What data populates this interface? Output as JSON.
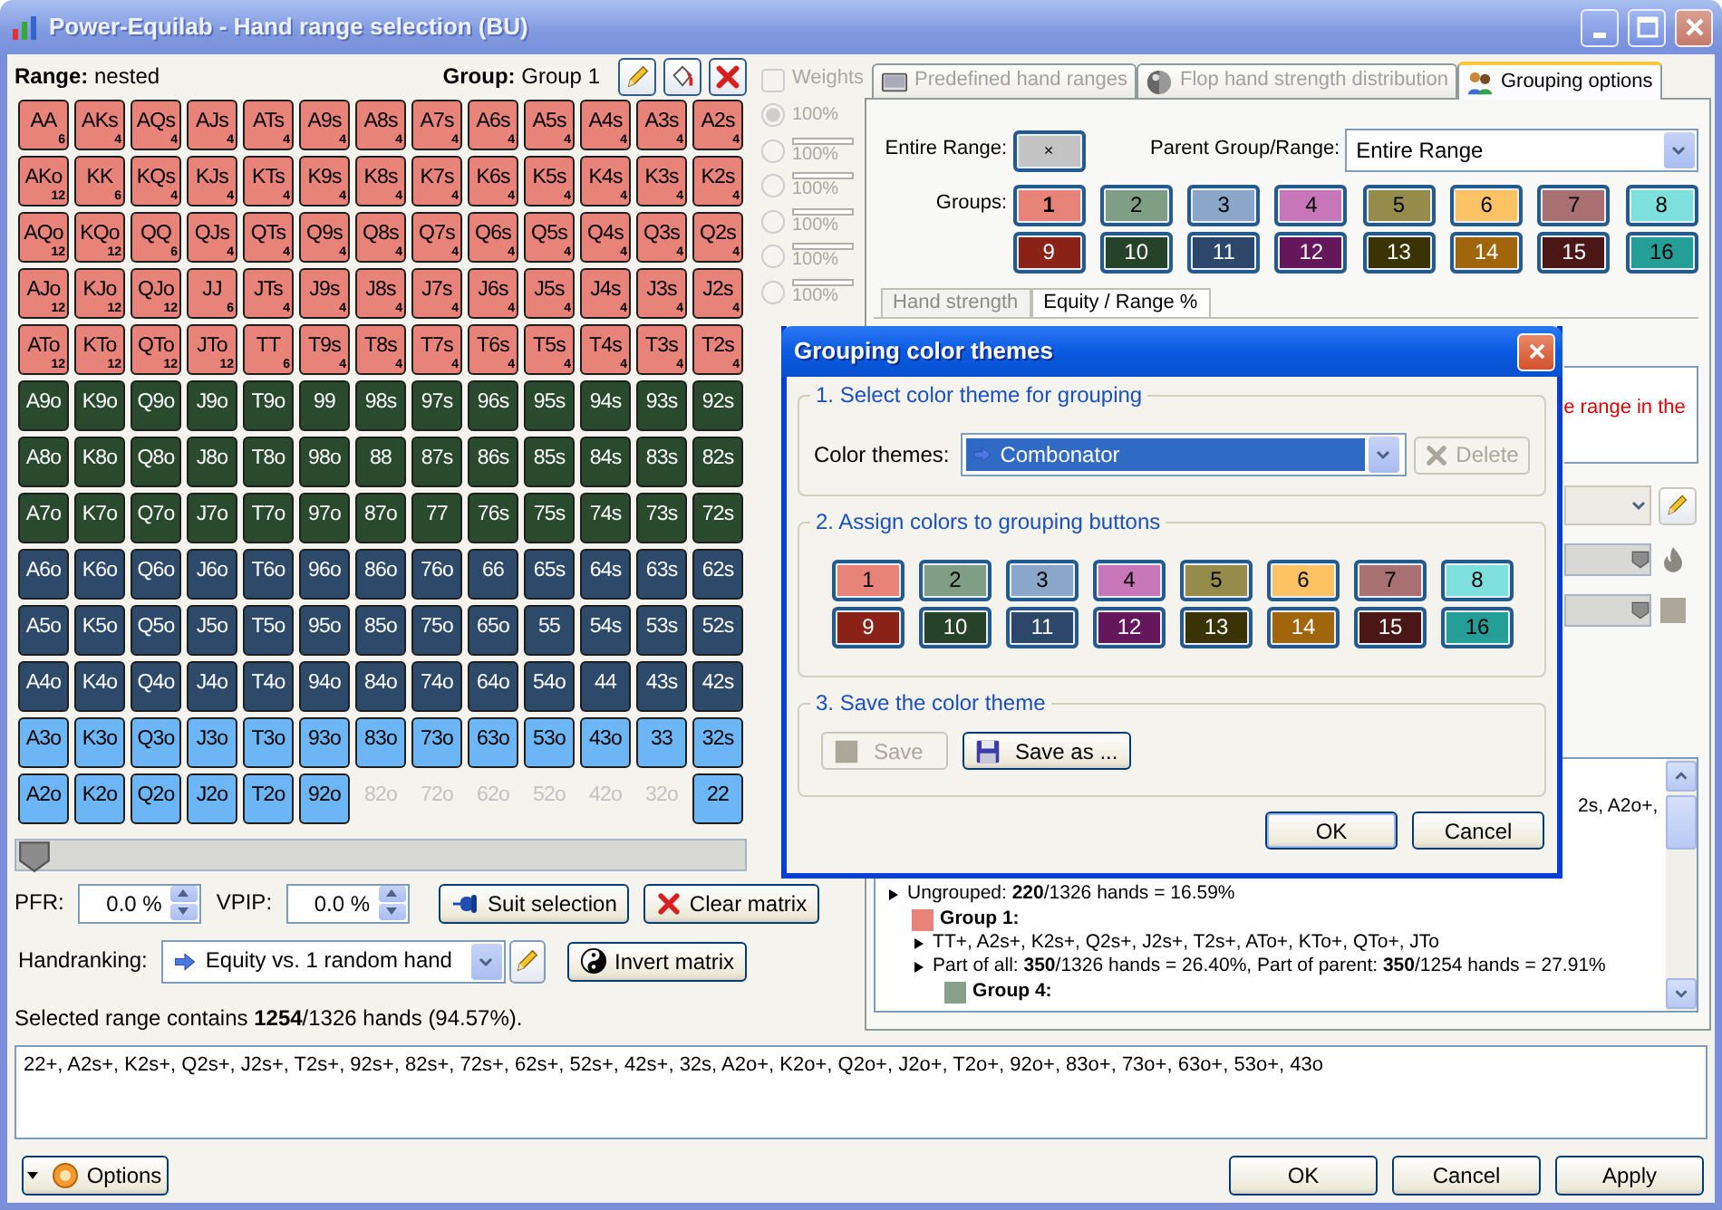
{
  "window": {
    "title": "Power-Equilab - Hand range selection (BU)"
  },
  "range_header": {
    "range_label": "**Range:** nested",
    "group_label": "**Group:** Group 1"
  },
  "matrix": {
    "rows": [
      {
        "cells": [
          {
            "hand": "AA",
            "combos": "6",
            "selected": true,
            "color": "#e8837a"
          },
          {
            "hand": "AKs",
            "combos": "4",
            "selected": true,
            "color": "#e8837a"
          },
          {
            "hand": "AQs",
            "combos": "4",
            "selected": true,
            "color": "#e8837a"
          },
          {
            "hand": "AJs",
            "combos": "4",
            "selected": true,
            "color": "#e8837a"
          },
          {
            "hand": "ATs",
            "combos": "4",
            "selected": true,
            "color": "#e8837a"
          },
          {
            "hand": "A9s",
            "combos": "4",
            "selected": true,
            "color": "#e8837a"
          },
          {
            "hand": "A8s",
            "combos": "4",
            "selected": true,
            "color": "#e8837a"
          },
          {
            "hand": "A7s",
            "combos": "4",
            "selected": true,
            "color": "#e8837a"
          },
          {
            "hand": "A6s",
            "combos": "4",
            "selected": true,
            "color": "#e8837a"
          },
          {
            "hand": "A5s",
            "combos": "4",
            "selected": true,
            "color": "#e8837a"
          },
          {
            "hand": "A4s",
            "combos": "4",
            "selected": true,
            "color": "#e8837a"
          },
          {
            "hand": "A3s",
            "combos": "4",
            "selected": true,
            "color": "#e8837a"
          },
          {
            "hand": "A2s",
            "combos": "4",
            "selected": true,
            "color": "#e8837a"
          }
        ]
      },
      {
        "cells": [
          {
            "hand": "AKo",
            "combos": "12",
            "selected": true,
            "color": "#e8837a"
          },
          {
            "hand": "KK",
            "combos": "6",
            "selected": true,
            "color": "#e8837a"
          },
          {
            "hand": "KQs",
            "combos": "4",
            "selected": true,
            "color": "#e8837a"
          },
          {
            "hand": "KJs",
            "combos": "4",
            "selected": true,
            "color": "#e8837a"
          },
          {
            "hand": "KTs",
            "combos": "4",
            "selected": true,
            "color": "#e8837a"
          },
          {
            "hand": "K9s",
            "combos": "4",
            "selected": true,
            "color": "#e8837a"
          },
          {
            "hand": "K8s",
            "combos": "4",
            "selected": true,
            "color": "#e8837a"
          },
          {
            "hand": "K7s",
            "combos": "4",
            "selected": true,
            "color": "#e8837a"
          },
          {
            "hand": "K6s",
            "combos": "4",
            "selected": true,
            "color": "#e8837a"
          },
          {
            "hand": "K5s",
            "combos": "4",
            "selected": true,
            "color": "#e8837a"
          },
          {
            "hand": "K4s",
            "combos": "4",
            "selected": true,
            "color": "#e8837a"
          },
          {
            "hand": "K3s",
            "combos": "4",
            "selected": true,
            "color": "#e8837a"
          },
          {
            "hand": "K2s",
            "combos": "4",
            "selected": true,
            "color": "#e8837a"
          }
        ]
      },
      {
        "cells": [
          {
            "hand": "AQo",
            "combos": "12",
            "selected": true,
            "color": "#e8837a"
          },
          {
            "hand": "KQo",
            "combos": "12",
            "selected": true,
            "color": "#e8837a"
          },
          {
            "hand": "QQ",
            "combos": "6",
            "selected": true,
            "color": "#e8837a"
          },
          {
            "hand": "QJs",
            "combos": "4",
            "selected": true,
            "color": "#e8837a"
          },
          {
            "hand": "QTs",
            "combos": "4",
            "selected": true,
            "color": "#e8837a"
          },
          {
            "hand": "Q9s",
            "combos": "4",
            "selected": true,
            "color": "#e8837a"
          },
          {
            "hand": "Q8s",
            "combos": "4",
            "selected": true,
            "color": "#e8837a"
          },
          {
            "hand": "Q7s",
            "combos": "4",
            "selected": true,
            "color": "#e8837a"
          },
          {
            "hand": "Q6s",
            "combos": "4",
            "selected": true,
            "color": "#e8837a"
          },
          {
            "hand": "Q5s",
            "combos": "4",
            "selected": true,
            "color": "#e8837a"
          },
          {
            "hand": "Q4s",
            "combos": "4",
            "selected": true,
            "color": "#e8837a"
          },
          {
            "hand": "Q3s",
            "combos": "4",
            "selected": true,
            "color": "#e8837a"
          },
          {
            "hand": "Q2s",
            "combos": "4",
            "selected": true,
            "color": "#e8837a"
          }
        ]
      },
      {
        "cells": [
          {
            "hand": "AJo",
            "combos": "12",
            "selected": true,
            "color": "#e8837a"
          },
          {
            "hand": "KJo",
            "combos": "12",
            "selected": true,
            "color": "#e8837a"
          },
          {
            "hand": "QJo",
            "combos": "12",
            "selected": true,
            "color": "#e8837a"
          },
          {
            "hand": "JJ",
            "combos": "6",
            "selected": true,
            "color": "#e8837a"
          },
          {
            "hand": "JTs",
            "combos": "4",
            "selected": true,
            "color": "#e8837a"
          },
          {
            "hand": "J9s",
            "combos": "4",
            "selected": true,
            "color": "#e8837a"
          },
          {
            "hand": "J8s",
            "combos": "4",
            "selected": true,
            "color": "#e8837a"
          },
          {
            "hand": "J7s",
            "combos": "4",
            "selected": true,
            "color": "#e8837a"
          },
          {
            "hand": "J6s",
            "combos": "4",
            "selected": true,
            "color": "#e8837a"
          },
          {
            "hand": "J5s",
            "combos": "4",
            "selected": true,
            "color": "#e8837a"
          },
          {
            "hand": "J4s",
            "combos": "4",
            "selected": true,
            "color": "#e8837a"
          },
          {
            "hand": "J3s",
            "combos": "4",
            "selected": true,
            "color": "#e8837a"
          },
          {
            "hand": "J2s",
            "combos": "4",
            "selected": true,
            "color": "#e8837a"
          }
        ]
      },
      {
        "cells": [
          {
            "hand": "ATo",
            "combos": "12",
            "selected": true,
            "color": "#e8837a"
          },
          {
            "hand": "KTo",
            "combos": "12",
            "selected": true,
            "color": "#e8837a"
          },
          {
            "hand": "QTo",
            "combos": "12",
            "selected": true,
            "color": "#e8837a"
          },
          {
            "hand": "JTo",
            "combos": "12",
            "selected": true,
            "color": "#e8837a"
          },
          {
            "hand": "TT",
            "combos": "6",
            "selected": true,
            "color": "#e8837a"
          },
          {
            "hand": "T9s",
            "combos": "4",
            "selected": true,
            "color": "#e8837a"
          },
          {
            "hand": "T8s",
            "combos": "4",
            "selected": true,
            "color": "#e8837a"
          },
          {
            "hand": "T7s",
            "combos": "4",
            "selected": true,
            "color": "#e8837a"
          },
          {
            "hand": "T6s",
            "combos": "4",
            "selected": true,
            "color": "#e8837a"
          },
          {
            "hand": "T5s",
            "combos": "4",
            "selected": true,
            "color": "#e8837a"
          },
          {
            "hand": "T4s",
            "combos": "4",
            "selected": true,
            "color": "#e8837a"
          },
          {
            "hand": "T3s",
            "combos": "4",
            "selected": true,
            "color": "#e8837a"
          },
          {
            "hand": "T2s",
            "combos": "4",
            "selected": true,
            "color": "#e8837a"
          }
        ]
      },
      {
        "cells": [
          {
            "hand": "A9o",
            "selected": true,
            "color": "#2a4a2d"
          },
          {
            "hand": "K9o",
            "selected": true,
            "color": "#2a4a2d"
          },
          {
            "hand": "Q9o",
            "selected": true,
            "color": "#2a4a2d"
          },
          {
            "hand": "J9o",
            "selected": true,
            "color": "#2a4a2d"
          },
          {
            "hand": "T9o",
            "selected": true,
            "color": "#2a4a2d"
          },
          {
            "hand": "99",
            "selected": true,
            "color": "#2a4a2d"
          },
          {
            "hand": "98s",
            "selected": true,
            "color": "#2a4a2d"
          },
          {
            "hand": "97s",
            "selected": true,
            "color": "#2a4a2d"
          },
          {
            "hand": "96s",
            "selected": true,
            "color": "#2a4a2d"
          },
          {
            "hand": "95s",
            "selected": true,
            "color": "#2a4a2d"
          },
          {
            "hand": "94s",
            "selected": true,
            "color": "#2a4a2d"
          },
          {
            "hand": "93s",
            "selected": true,
            "color": "#2a4a2d"
          },
          {
            "hand": "92s",
            "selected": true,
            "color": "#2a4a2d"
          }
        ]
      },
      {
        "cells": [
          {
            "hand": "A8o",
            "selected": true,
            "color": "#2a4a2d"
          },
          {
            "hand": "K8o",
            "selected": true,
            "color": "#2a4a2d"
          },
          {
            "hand": "Q8o",
            "selected": true,
            "color": "#2a4a2d"
          },
          {
            "hand": "J8o",
            "selected": true,
            "color": "#2a4a2d"
          },
          {
            "hand": "T8o",
            "selected": true,
            "color": "#2a4a2d"
          },
          {
            "hand": "98o",
            "selected": true,
            "color": "#2a4a2d"
          },
          {
            "hand": "88",
            "selected": true,
            "color": "#2a4a2d"
          },
          {
            "hand": "87s",
            "selected": true,
            "color": "#2a4a2d"
          },
          {
            "hand": "86s",
            "selected": true,
            "color": "#2a4a2d"
          },
          {
            "hand": "85s",
            "selected": true,
            "color": "#2a4a2d"
          },
          {
            "hand": "84s",
            "selected": true,
            "color": "#2a4a2d"
          },
          {
            "hand": "83s",
            "selected": true,
            "color": "#2a4a2d"
          },
          {
            "hand": "82s",
            "selected": true,
            "color": "#2a4a2d"
          }
        ]
      },
      {
        "cells": [
          {
            "hand": "A7o",
            "selected": true,
            "color": "#2a4a2d"
          },
          {
            "hand": "K7o",
            "selected": true,
            "color": "#2a4a2d"
          },
          {
            "hand": "Q7o",
            "selected": true,
            "color": "#2a4a2d"
          },
          {
            "hand": "J7o",
            "selected": true,
            "color": "#2a4a2d"
          },
          {
            "hand": "T7o",
            "selected": true,
            "color": "#2a4a2d"
          },
          {
            "hand": "97o",
            "selected": true,
            "color": "#2a4a2d"
          },
          {
            "hand": "87o",
            "selected": true,
            "color": "#2a4a2d"
          },
          {
            "hand": "77",
            "selected": true,
            "color": "#2a4a2d"
          },
          {
            "hand": "76s",
            "selected": true,
            "color": "#2a4a2d"
          },
          {
            "hand": "75s",
            "selected": true,
            "color": "#2a4a2d"
          },
          {
            "hand": "74s",
            "selected": true,
            "color": "#2a4a2d"
          },
          {
            "hand": "73s",
            "selected": true,
            "color": "#2a4a2d"
          },
          {
            "hand": "72s",
            "selected": true,
            "color": "#2a4a2d"
          }
        ]
      },
      {
        "cells": [
          {
            "hand": "A6o",
            "selected": true,
            "color": "#2d4a6b"
          },
          {
            "hand": "K6o",
            "selected": true,
            "color": "#2d4a6b"
          },
          {
            "hand": "Q6o",
            "selected": true,
            "color": "#2d4a6b"
          },
          {
            "hand": "J6o",
            "selected": true,
            "color": "#2d4a6b"
          },
          {
            "hand": "T6o",
            "selected": true,
            "color": "#2d4a6b"
          },
          {
            "hand": "96o",
            "selected": true,
            "color": "#2d4a6b"
          },
          {
            "hand": "86o",
            "selected": true,
            "color": "#2d4a6b"
          },
          {
            "hand": "76o",
            "selected": true,
            "color": "#2d4a6b"
          },
          {
            "hand": "66",
            "selected": true,
            "color": "#2d4a6b"
          },
          {
            "hand": "65s",
            "selected": true,
            "color": "#2d4a6b"
          },
          {
            "hand": "64s",
            "selected": true,
            "color": "#2d4a6b"
          },
          {
            "hand": "63s",
            "selected": true,
            "color": "#2d4a6b"
          },
          {
            "hand": "62s",
            "selected": true,
            "color": "#2d4a6b"
          }
        ]
      },
      {
        "cells": [
          {
            "hand": "A5o",
            "selected": true,
            "color": "#2d4a6b"
          },
          {
            "hand": "K5o",
            "selected": true,
            "color": "#2d4a6b"
          },
          {
            "hand": "Q5o",
            "selected": true,
            "color": "#2d4a6b"
          },
          {
            "hand": "J5o",
            "selected": true,
            "color": "#2d4a6b"
          },
          {
            "hand": "T5o",
            "selected": true,
            "color": "#2d4a6b"
          },
          {
            "hand": "95o",
            "selected": true,
            "color": "#2d4a6b"
          },
          {
            "hand": "85o",
            "selected": true,
            "color": "#2d4a6b"
          },
          {
            "hand": "75o",
            "selected": true,
            "color": "#2d4a6b"
          },
          {
            "hand": "65o",
            "selected": true,
            "color": "#2d4a6b"
          },
          {
            "hand": "55",
            "selected": true,
            "color": "#2d4a6b"
          },
          {
            "hand": "54s",
            "selected": true,
            "color": "#2d4a6b"
          },
          {
            "hand": "53s",
            "selected": true,
            "color": "#2d4a6b"
          },
          {
            "hand": "52s",
            "selected": true,
            "color": "#2d4a6b"
          }
        ]
      },
      {
        "cells": [
          {
            "hand": "A4o",
            "selected": true,
            "color": "#2d4a6b"
          },
          {
            "hand": "K4o",
            "selected": true,
            "color": "#2d4a6b"
          },
          {
            "hand": "Q4o",
            "selected": true,
            "color": "#2d4a6b"
          },
          {
            "hand": "J4o",
            "selected": true,
            "color": "#2d4a6b"
          },
          {
            "hand": "T4o",
            "selected": true,
            "color": "#2d4a6b"
          },
          {
            "hand": "94o",
            "selected": true,
            "color": "#2d4a6b"
          },
          {
            "hand": "84o",
            "selected": true,
            "color": "#2d4a6b"
          },
          {
            "hand": "74o",
            "selected": true,
            "color": "#2d4a6b"
          },
          {
            "hand": "64o",
            "selected": true,
            "color": "#2d4a6b"
          },
          {
            "hand": "54o",
            "selected": true,
            "color": "#2d4a6b"
          },
          {
            "hand": "44",
            "selected": true,
            "color": "#2d4a6b"
          },
          {
            "hand": "43s",
            "selected": true,
            "color": "#2d4a6b"
          },
          {
            "hand": "42s",
            "selected": true,
            "color": "#2d4a6b"
          }
        ]
      },
      {
        "cells": [
          {
            "hand": "A3o",
            "selected": true,
            "color": "#6db6f6"
          },
          {
            "hand": "K3o",
            "selected": true,
            "color": "#6db6f6"
          },
          {
            "hand": "Q3o",
            "selected": true,
            "color": "#6db6f6"
          },
          {
            "hand": "J3o",
            "selected": true,
            "color": "#6db6f6"
          },
          {
            "hand": "T3o",
            "selected": true,
            "color": "#6db6f6"
          },
          {
            "hand": "93o",
            "selected": true,
            "color": "#6db6f6"
          },
          {
            "hand": "83o",
            "selected": true,
            "color": "#6db6f6"
          },
          {
            "hand": "73o",
            "selected": true,
            "color": "#6db6f6"
          },
          {
            "hand": "63o",
            "selected": true,
            "color": "#6db6f6"
          },
          {
            "hand": "53o",
            "selected": true,
            "color": "#6db6f6"
          },
          {
            "hand": "43o",
            "selected": true,
            "color": "#6db6f6"
          },
          {
            "hand": "33",
            "selected": true,
            "color": "#6db6f6"
          },
          {
            "hand": "32s",
            "selected": true,
            "color": "#6db6f6"
          }
        ]
      },
      {
        "cells": [
          {
            "hand": "A2o",
            "selected": true,
            "color": "#6db6f6"
          },
          {
            "hand": "K2o",
            "selected": true,
            "color": "#6db6f6"
          },
          {
            "hand": "Q2o",
            "selected": true,
            "color": "#6db6f6"
          },
          {
            "hand": "J2o",
            "selected": true,
            "color": "#6db6f6"
          },
          {
            "hand": "T2o",
            "selected": true,
            "color": "#6db6f6"
          },
          {
            "hand": "92o",
            "selected": true,
            "color": "#6db6f6"
          },
          {
            "hand": "82o",
            "selected": false
          },
          {
            "hand": "72o",
            "selected": false
          },
          {
            "hand": "62o",
            "selected": false
          },
          {
            "hand": "52o",
            "selected": false
          },
          {
            "hand": "42o",
            "selected": false
          },
          {
            "hand": "32o",
            "selected": false
          },
          {
            "hand": "22",
            "selected": true,
            "color": "#6db6f6"
          }
        ]
      }
    ]
  },
  "range_slider": {
    "level": 0
  },
  "pfr": {
    "label": "PFR:",
    "value": "0.0 %"
  },
  "vpip": {
    "label": "VPIP:",
    "value": "0.0 %"
  },
  "suit_selection": "Suit selection",
  "clear_matrix": "Clear matrix",
  "handranking": {
    "label": "Handranking:",
    "value": "Equity vs. 1 random hand"
  },
  "invert_matrix": "Invert matrix",
  "range_summary": "Selected range contains **1254**/1326 hands (94.57%).",
  "weights": {
    "label": "Weights",
    "checked": false,
    "disabled": true,
    "items": [
      {
        "label": "100%",
        "selected": true,
        "kind": "fixed"
      },
      {
        "label": "100%",
        "selected": false,
        "kind": "bar"
      },
      {
        "label": "100%",
        "selected": false,
        "kind": "bar"
      },
      {
        "label": "100%",
        "selected": false,
        "kind": "bar"
      },
      {
        "label": "100%",
        "selected": false,
        "kind": "bar"
      },
      {
        "label": "100%",
        "selected": false,
        "kind": "bar"
      }
    ]
  },
  "tabs": [
    {
      "label": "Predefined hand ranges",
      "selected": false
    },
    {
      "label": "Flop hand strength distribution",
      "selected": false
    },
    {
      "label": "Grouping options",
      "selected": true
    }
  ],
  "grouping": {
    "entire_range_label": "Entire Range:",
    "entire_range_button": "×",
    "parent_label": "Parent Group/Range:",
    "parent_value": "Entire Range",
    "groups_label": "Groups:",
    "groups": [
      {
        "label": "1",
        "color": "#e8837a",
        "selected": true
      },
      {
        "label": "2",
        "color": "#7f9e84",
        "selected": false
      },
      {
        "label": "3",
        "color": "#8aa6c8",
        "selected": false
      },
      {
        "label": "4",
        "color": "#c777b9",
        "selected": false
      },
      {
        "label": "5",
        "color": "#958c4c",
        "selected": false
      },
      {
        "label": "6",
        "color": "#fcc365",
        "selected": false
      },
      {
        "label": "7",
        "color": "#a87070",
        "selected": false
      },
      {
        "label": "8",
        "color": "#7ee0dc",
        "selected": false
      },
      {
        "label": "9",
        "color": "#8a2218",
        "selected": false
      },
      {
        "label": "10",
        "color": "#264229",
        "selected": false
      },
      {
        "label": "11",
        "color": "#2c4769",
        "selected": false
      },
      {
        "label": "12",
        "color": "#64175a",
        "selected": false
      },
      {
        "label": "13",
        "color": "#3a3306",
        "selected": false
      },
      {
        "label": "14",
        "color": "#a1660c",
        "selected": false
      },
      {
        "label": "15",
        "color": "#4a1616",
        "selected": false
      },
      {
        "label": "16",
        "color": "#259e98",
        "selected": false
      }
    ],
    "subtabs": [
      {
        "label": "Hand strength",
        "selected": false
      },
      {
        "label": "Equity / Range %",
        "selected": true
      }
    ],
    "note_fragment": "e range in the",
    "dropdown": {
      "disabled": true
    },
    "sliders": [
      {
        "level": 1
      },
      {
        "level": 1
      }
    ],
    "summary": {
      "fragment": "2s, A2o+,",
      "ungrouped": "Ungrouped: **220**/1326 hands = 16.59%",
      "groups": [
        {
          "name": "Group 1:",
          "color": "#e8837a",
          "details": [
            "TT+, A2s+, K2s+, Q2s+, J2s+, T2s+, ATo+, KTo+, QTo+, JTo",
            "Part of all: **350**/1326 hands = 26.40%, Part of parent: **350**/1254 hands = 27.91%"
          ],
          "children": [
            {
              "name": "Group 4:",
              "color": "#86a08a"
            }
          ]
        }
      ]
    }
  },
  "range_text": "22+, A2s+, K2s+, Q2s+, J2s+, T2s+, 92s+, 82s+, 72s+, 62s+, 52s+, 42s+, 32s, A2o+, K2o+, Q2o+, J2o+, T2o+, 92o+, 83o+, 73o+, 63o+, 53o+, 43o",
  "options_button": "Options",
  "footer": {
    "ok": "OK",
    "cancel": "Cancel",
    "apply": "Apply"
  },
  "dialog": {
    "title": "Grouping color themes",
    "section_1": {
      "legend": "1. Select color theme for grouping",
      "label": "Color themes:",
      "value": "Combonator",
      "delete": {
        "label": "Delete",
        "disabled": true
      }
    },
    "section_2": {
      "legend": "2. Assign colors to grouping buttons",
      "buttons": [
        {
          "label": "1",
          "color": "#e8837a"
        },
        {
          "label": "2",
          "color": "#7f9e84"
        },
        {
          "label": "3",
          "color": "#8aa6c8"
        },
        {
          "label": "4",
          "color": "#c777b9"
        },
        {
          "label": "5",
          "color": "#958c4c"
        },
        {
          "label": "6",
          "color": "#fcc365"
        },
        {
          "label": "7",
          "color": "#a87070"
        },
        {
          "label": "8",
          "color": "#7ee0dc"
        },
        {
          "label": "9",
          "color": "#8a2218"
        },
        {
          "label": "10",
          "color": "#264229"
        },
        {
          "label": "11",
          "color": "#2c4769"
        },
        {
          "label": "12",
          "color": "#64175a"
        },
        {
          "label": "13",
          "color": "#3a3306"
        },
        {
          "label": "14",
          "color": "#a1660c"
        },
        {
          "label": "15",
          "color": "#4a1616"
        },
        {
          "label": "16",
          "color": "#259e98"
        }
      ]
    },
    "section_3": {
      "legend": "3. Save the color theme",
      "save": {
        "label": "Save",
        "disabled": true
      },
      "save_as": {
        "label": "Save as ...",
        "disabled": false
      }
    },
    "ok": "OK",
    "cancel": "Cancel"
  }
}
